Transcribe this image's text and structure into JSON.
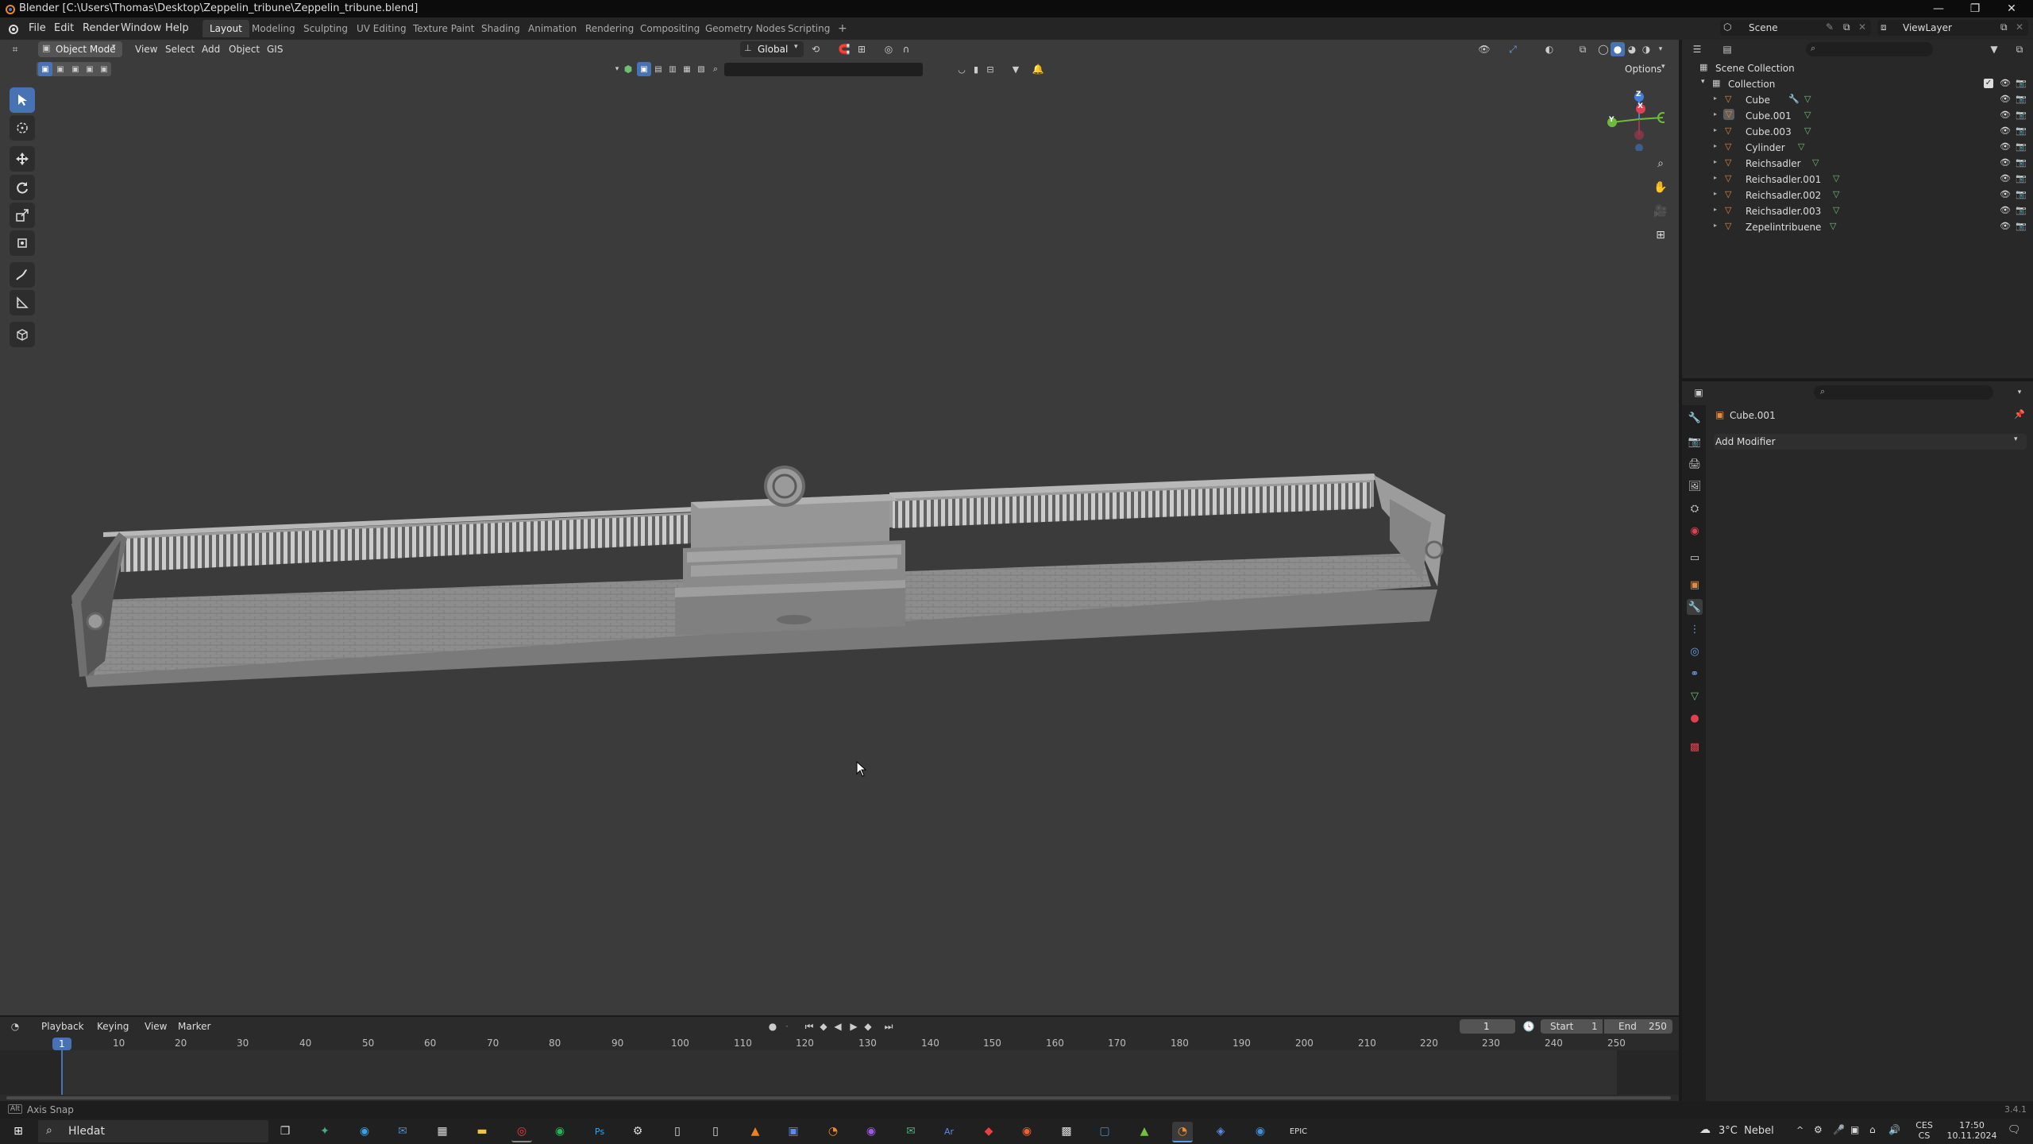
{
  "window": {
    "title": "Blender [C:\\Users\\Thomas\\Desktop\\Zeppelin_tribune\\Zeppelin_tribune.blend]",
    "minimize": "—",
    "maximize": "❐",
    "close": "✕"
  },
  "menu": {
    "items": [
      "File",
      "Edit",
      "Render",
      "Window",
      "Help"
    ],
    "workspaces": [
      "Layout",
      "Modeling",
      "Sculpting",
      "UV Editing",
      "Texture Paint",
      "Shading",
      "Animation",
      "Rendering",
      "Compositing",
      "Geometry Nodes",
      "Scripting"
    ],
    "active_workspace": "Layout",
    "add_tab": "+",
    "scene": "Scene",
    "view_layer": "ViewLayer"
  },
  "viewport": {
    "mode": "Object Mode",
    "menus": [
      "View",
      "Select",
      "Add",
      "Object",
      "GIS"
    ],
    "orientation": "Global",
    "options": "Options",
    "gizmo_axes": {
      "x": "X",
      "y": "Y",
      "z": "Z"
    }
  },
  "outliner": {
    "root": "Scene Collection",
    "collection": "Collection",
    "objects": [
      "Cube",
      "Cube.001",
      "Cube.003",
      "Cylinder",
      "Reichsadler",
      "Reichsadler.001",
      "Reichsadler.002",
      "Reichsadler.003",
      "Zepelintribuene"
    ],
    "selected_object": "Cube.001"
  },
  "properties": {
    "object_name": "Cube.001",
    "add_modifier": "Add Modifier"
  },
  "timeline": {
    "menus": [
      "Playback",
      "Keying",
      "View",
      "Marker"
    ],
    "current_frame": "1",
    "start_label": "Start",
    "start": "1",
    "end_label": "End",
    "end": "250",
    "ticks": [
      "10",
      "20",
      "30",
      "40",
      "50",
      "60",
      "70",
      "80",
      "90",
      "100",
      "110",
      "120",
      "130",
      "140",
      "150",
      "160",
      "170",
      "180",
      "190",
      "200",
      "210",
      "220",
      "230",
      "240",
      "250"
    ],
    "playhead": "1"
  },
  "status": {
    "left": "Axis Snap",
    "version": "3.4.1"
  },
  "taskbar": {
    "search_placeholder": "Hledat",
    "weather": "3°C  Nebel",
    "lang_top": "CES",
    "lang_bottom": "CS",
    "time": "17:50",
    "date": "10.11.2024"
  },
  "colors": {
    "accent": "#4772b3",
    "viewport_bg": "#3b3b3b",
    "panel_bg": "#282828",
    "object_orange": "#e48a3c",
    "mesh_green": "#6fbf73",
    "axis_x": "#e04050",
    "axis_y": "#6cbc3c",
    "axis_z": "#3f7fe0"
  }
}
